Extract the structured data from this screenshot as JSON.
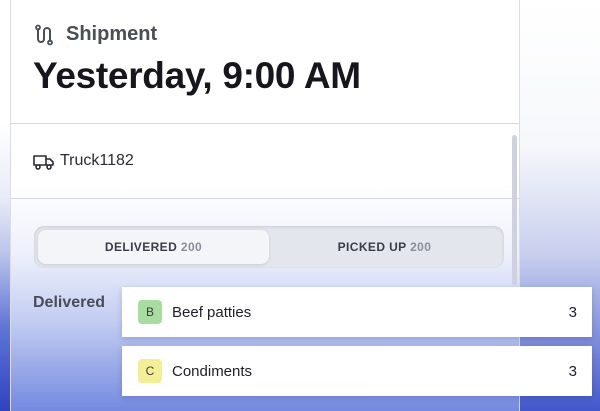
{
  "header": {
    "icon": "route-icon",
    "label": "Shipment",
    "datetime": "Yesterday, 9:00 AM"
  },
  "vehicle": {
    "icon": "truck-icon",
    "name": "Truck1182"
  },
  "tabs": [
    {
      "label": "DELIVERED",
      "count": "200",
      "active": true
    },
    {
      "label": "PICKED UP",
      "count": "200",
      "active": false
    }
  ],
  "section": {
    "label": "Delivered"
  },
  "items": [
    {
      "badge": "B",
      "badge_color": "#a8dca0",
      "name": "Beef patties",
      "qty": "3"
    },
    {
      "badge": "C",
      "badge_color": "#f4ee96",
      "name": "Condiments",
      "qty": "3"
    }
  ]
}
